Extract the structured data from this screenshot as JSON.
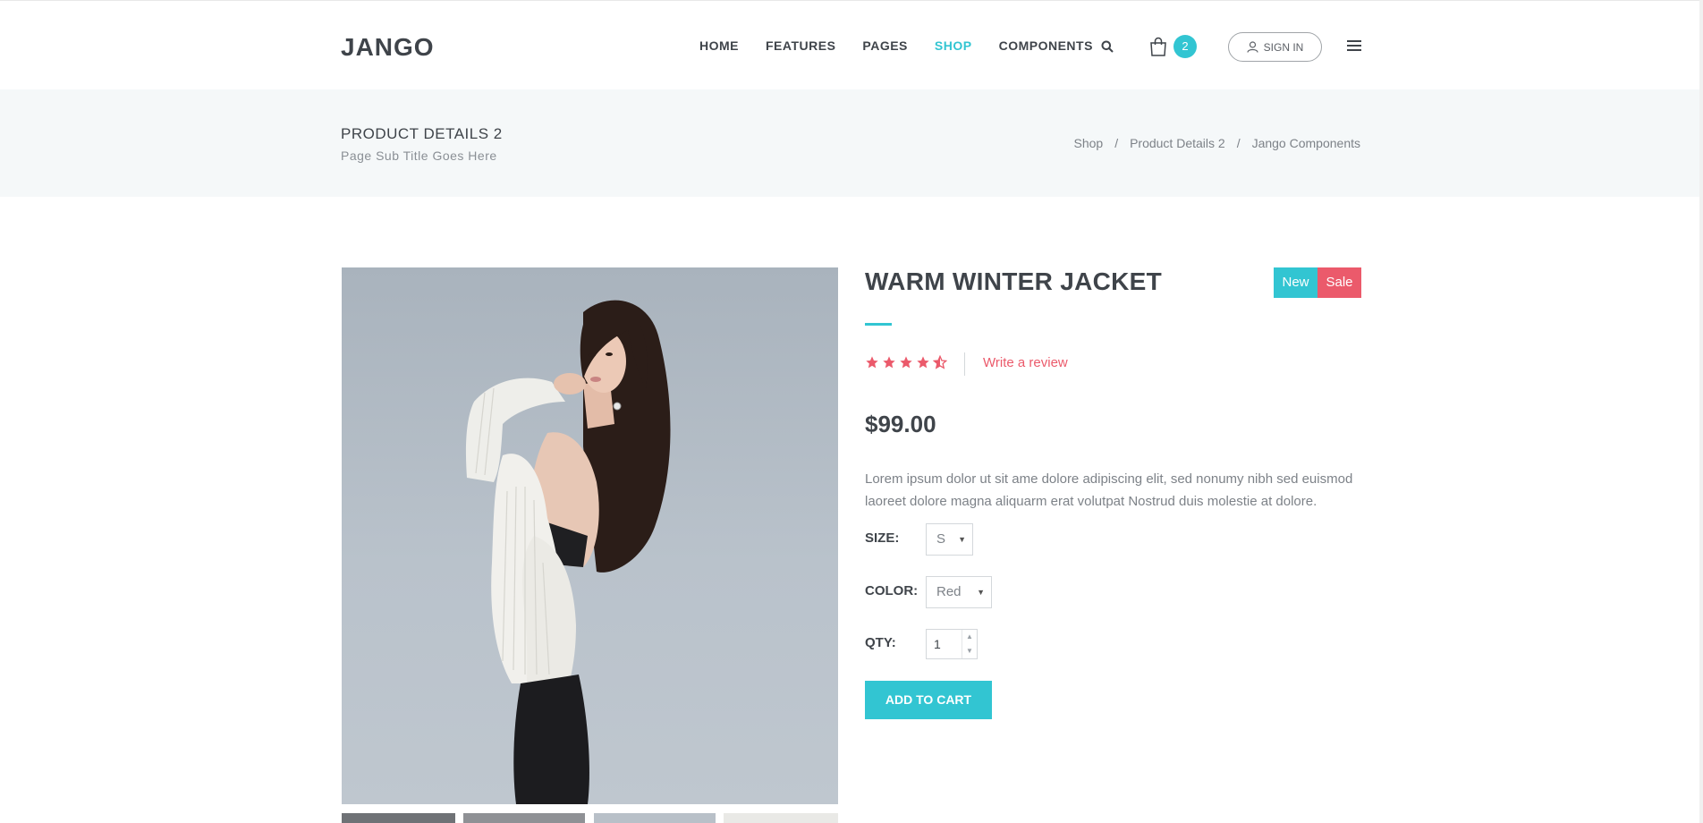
{
  "header": {
    "logo": "JANGO",
    "nav": [
      {
        "label": "HOME",
        "active": false
      },
      {
        "label": "FEATURES",
        "active": false
      },
      {
        "label": "PAGES",
        "active": false
      },
      {
        "label": "SHOP",
        "active": true
      },
      {
        "label": "COMPONENTS",
        "active": false
      }
    ],
    "cart_count": "2",
    "signin_label": "SIGN IN"
  },
  "titlebar": {
    "title": "PRODUCT DETAILS 2",
    "subtitle": "Page Sub Title Goes Here",
    "breadcrumb": [
      "Shop",
      "Product Details 2",
      "Jango Components"
    ],
    "separator": "/"
  },
  "product": {
    "title": "WARM WINTER JACKET",
    "badge_new": "New",
    "badge_sale": "Sale",
    "rating": 4.5,
    "rating_max": 5,
    "write_review": "Write a review",
    "price": "$99.00",
    "description": "Lorem ipsum dolor ut sit ame dolore adipiscing elit, sed nonumy nibh sed euismod laoreet dolore magna aliquarm erat volutpat Nostrud duis molestie at dolore.",
    "size_label": "SIZE:",
    "size_value": "S",
    "color_label": "COLOR:",
    "color_value": "Red",
    "qty_label": "QTY:",
    "qty_value": "1",
    "add_to_cart": "ADD TO CART"
  },
  "icons": {
    "search": "search-icon",
    "cart": "shopping-bag-icon",
    "user": "user-icon",
    "menu": "hamburger-menu-icon",
    "star": "star-icon"
  },
  "colors": {
    "accent": "#32c5d2",
    "sale": "#eb5a6b",
    "text": "#3f444a",
    "muted": "#7d8288",
    "titlebar_bg": "#f5f8f9"
  }
}
